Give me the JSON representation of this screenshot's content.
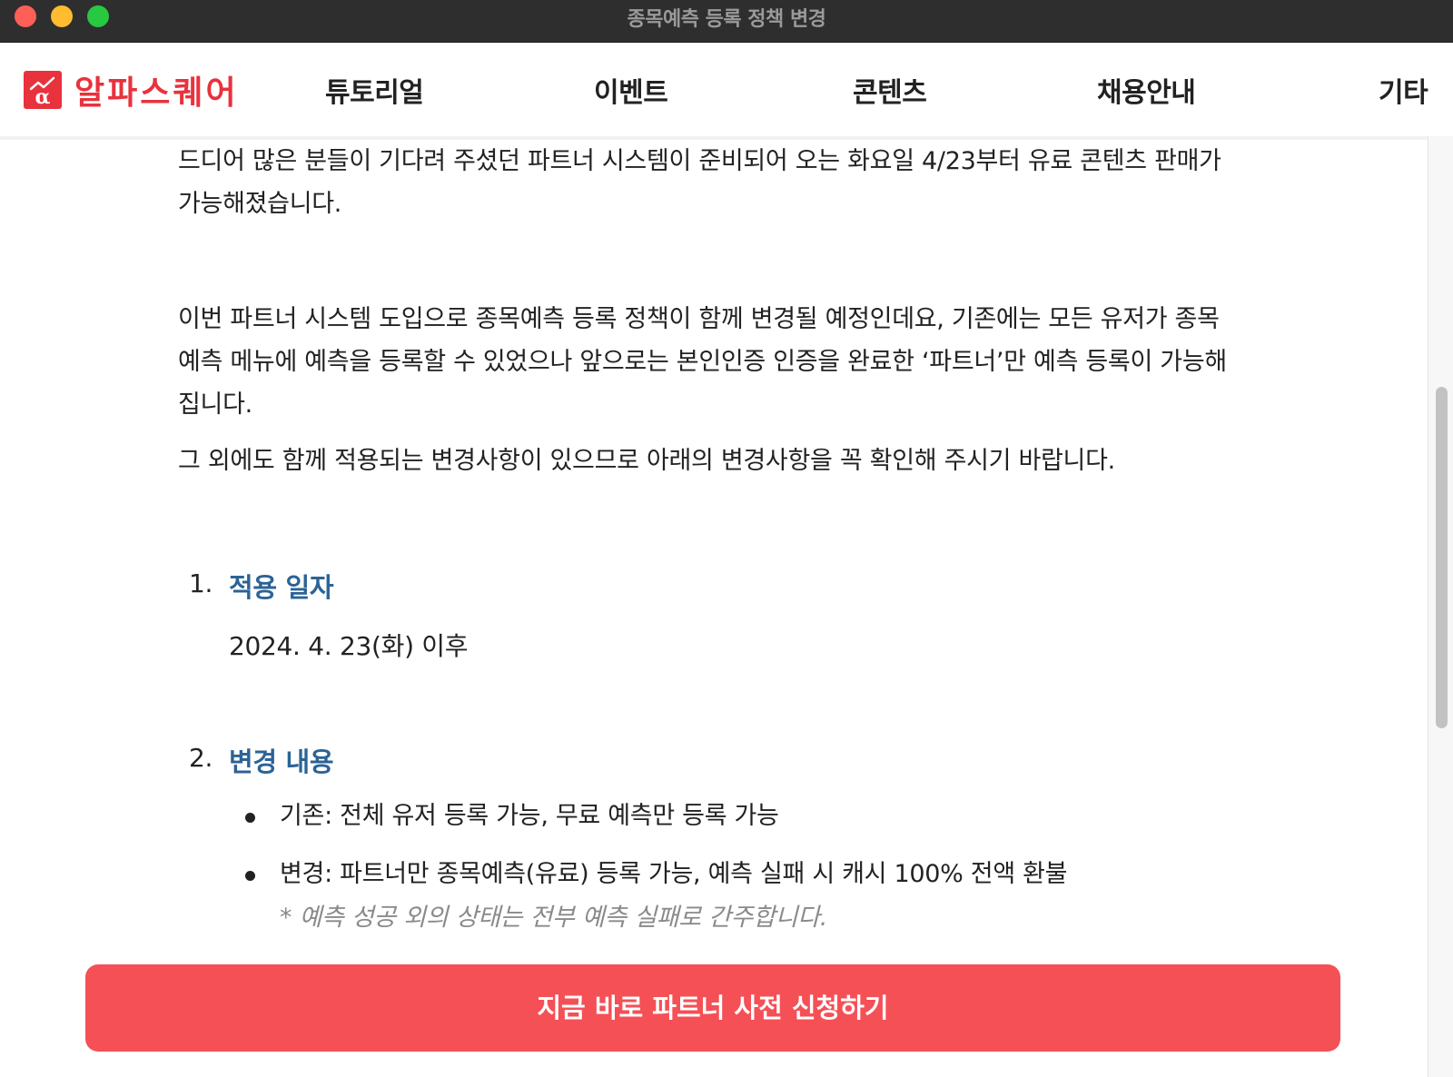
{
  "window": {
    "title": "종목예측 등록 정책 변경"
  },
  "nav": {
    "logo_text": "알파스퀘어",
    "items": [
      "튜토리얼",
      "이벤트",
      "콘텐츠",
      "채용안내",
      "기타"
    ]
  },
  "content": {
    "paragraphs": [
      "드디어 많은 분들이 기다려 주셨던 파트너 시스템이 준비되어 오는 화요일 4/23부터 유료 콘텐츠 판매가 가능해졌습니다.",
      "이번 파트너 시스템 도입으로 종목예측 등록 정책이 함께 변경될 예정인데요, 기존에는 모든 유저가 종목예측 메뉴에 예측을 등록할 수 있었으나 앞으로는 본인인증 인증을 완료한 ‘파트너’만 예측 등록이 가능해집니다.",
      "그 외에도 함께 적용되는 변경사항이 있으므로 아래의 변경사항을 꼭 확인해 주시기 바랍니다."
    ],
    "sections": [
      {
        "number": "1.",
        "title": "적용 일자",
        "body": "2024. 4. 23(화) 이후"
      },
      {
        "number": "2.",
        "title": "변경 내용",
        "bullets": [
          "기존: 전체 유저 등록 가능, 무료 예측만 등록 가능",
          "변경: 파트너만 종목예측(유료) 등록 가능, 예측 실패 시 캐시 100% 전액 환불"
        ],
        "note": "* 예측 성공 외의 상태는 전부 예측 실패로 간주합니다."
      }
    ]
  },
  "cta": {
    "label": "지금 바로 파트너 사전 신청하기"
  },
  "colors": {
    "brand": "#e8323c",
    "cta": "#f55056",
    "section_title": "#2c6396"
  }
}
